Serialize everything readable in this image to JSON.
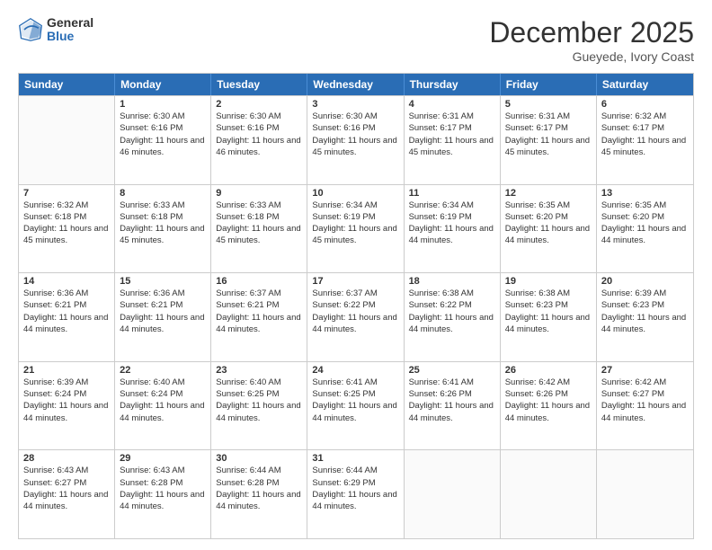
{
  "header": {
    "logo_general": "General",
    "logo_blue": "Blue",
    "month_title": "December 2025",
    "location": "Gueyede, Ivory Coast"
  },
  "days_of_week": [
    "Sunday",
    "Monday",
    "Tuesday",
    "Wednesday",
    "Thursday",
    "Friday",
    "Saturday"
  ],
  "weeks": [
    [
      {
        "day": "",
        "empty": true
      },
      {
        "day": "1",
        "sunrise": "Sunrise: 6:30 AM",
        "sunset": "Sunset: 6:16 PM",
        "daylight": "Daylight: 11 hours and 46 minutes."
      },
      {
        "day": "2",
        "sunrise": "Sunrise: 6:30 AM",
        "sunset": "Sunset: 6:16 PM",
        "daylight": "Daylight: 11 hours and 46 minutes."
      },
      {
        "day": "3",
        "sunrise": "Sunrise: 6:30 AM",
        "sunset": "Sunset: 6:16 PM",
        "daylight": "Daylight: 11 hours and 45 minutes."
      },
      {
        "day": "4",
        "sunrise": "Sunrise: 6:31 AM",
        "sunset": "Sunset: 6:17 PM",
        "daylight": "Daylight: 11 hours and 45 minutes."
      },
      {
        "day": "5",
        "sunrise": "Sunrise: 6:31 AM",
        "sunset": "Sunset: 6:17 PM",
        "daylight": "Daylight: 11 hours and 45 minutes."
      },
      {
        "day": "6",
        "sunrise": "Sunrise: 6:32 AM",
        "sunset": "Sunset: 6:17 PM",
        "daylight": "Daylight: 11 hours and 45 minutes."
      }
    ],
    [
      {
        "day": "7",
        "sunrise": "Sunrise: 6:32 AM",
        "sunset": "Sunset: 6:18 PM",
        "daylight": "Daylight: 11 hours and 45 minutes."
      },
      {
        "day": "8",
        "sunrise": "Sunrise: 6:33 AM",
        "sunset": "Sunset: 6:18 PM",
        "daylight": "Daylight: 11 hours and 45 minutes."
      },
      {
        "day": "9",
        "sunrise": "Sunrise: 6:33 AM",
        "sunset": "Sunset: 6:18 PM",
        "daylight": "Daylight: 11 hours and 45 minutes."
      },
      {
        "day": "10",
        "sunrise": "Sunrise: 6:34 AM",
        "sunset": "Sunset: 6:19 PM",
        "daylight": "Daylight: 11 hours and 45 minutes."
      },
      {
        "day": "11",
        "sunrise": "Sunrise: 6:34 AM",
        "sunset": "Sunset: 6:19 PM",
        "daylight": "Daylight: 11 hours and 44 minutes."
      },
      {
        "day": "12",
        "sunrise": "Sunrise: 6:35 AM",
        "sunset": "Sunset: 6:20 PM",
        "daylight": "Daylight: 11 hours and 44 minutes."
      },
      {
        "day": "13",
        "sunrise": "Sunrise: 6:35 AM",
        "sunset": "Sunset: 6:20 PM",
        "daylight": "Daylight: 11 hours and 44 minutes."
      }
    ],
    [
      {
        "day": "14",
        "sunrise": "Sunrise: 6:36 AM",
        "sunset": "Sunset: 6:21 PM",
        "daylight": "Daylight: 11 hours and 44 minutes."
      },
      {
        "day": "15",
        "sunrise": "Sunrise: 6:36 AM",
        "sunset": "Sunset: 6:21 PM",
        "daylight": "Daylight: 11 hours and 44 minutes."
      },
      {
        "day": "16",
        "sunrise": "Sunrise: 6:37 AM",
        "sunset": "Sunset: 6:21 PM",
        "daylight": "Daylight: 11 hours and 44 minutes."
      },
      {
        "day": "17",
        "sunrise": "Sunrise: 6:37 AM",
        "sunset": "Sunset: 6:22 PM",
        "daylight": "Daylight: 11 hours and 44 minutes."
      },
      {
        "day": "18",
        "sunrise": "Sunrise: 6:38 AM",
        "sunset": "Sunset: 6:22 PM",
        "daylight": "Daylight: 11 hours and 44 minutes."
      },
      {
        "day": "19",
        "sunrise": "Sunrise: 6:38 AM",
        "sunset": "Sunset: 6:23 PM",
        "daylight": "Daylight: 11 hours and 44 minutes."
      },
      {
        "day": "20",
        "sunrise": "Sunrise: 6:39 AM",
        "sunset": "Sunset: 6:23 PM",
        "daylight": "Daylight: 11 hours and 44 minutes."
      }
    ],
    [
      {
        "day": "21",
        "sunrise": "Sunrise: 6:39 AM",
        "sunset": "Sunset: 6:24 PM",
        "daylight": "Daylight: 11 hours and 44 minutes."
      },
      {
        "day": "22",
        "sunrise": "Sunrise: 6:40 AM",
        "sunset": "Sunset: 6:24 PM",
        "daylight": "Daylight: 11 hours and 44 minutes."
      },
      {
        "day": "23",
        "sunrise": "Sunrise: 6:40 AM",
        "sunset": "Sunset: 6:25 PM",
        "daylight": "Daylight: 11 hours and 44 minutes."
      },
      {
        "day": "24",
        "sunrise": "Sunrise: 6:41 AM",
        "sunset": "Sunset: 6:25 PM",
        "daylight": "Daylight: 11 hours and 44 minutes."
      },
      {
        "day": "25",
        "sunrise": "Sunrise: 6:41 AM",
        "sunset": "Sunset: 6:26 PM",
        "daylight": "Daylight: 11 hours and 44 minutes."
      },
      {
        "day": "26",
        "sunrise": "Sunrise: 6:42 AM",
        "sunset": "Sunset: 6:26 PM",
        "daylight": "Daylight: 11 hours and 44 minutes."
      },
      {
        "day": "27",
        "sunrise": "Sunrise: 6:42 AM",
        "sunset": "Sunset: 6:27 PM",
        "daylight": "Daylight: 11 hours and 44 minutes."
      }
    ],
    [
      {
        "day": "28",
        "sunrise": "Sunrise: 6:43 AM",
        "sunset": "Sunset: 6:27 PM",
        "daylight": "Daylight: 11 hours and 44 minutes."
      },
      {
        "day": "29",
        "sunrise": "Sunrise: 6:43 AM",
        "sunset": "Sunset: 6:28 PM",
        "daylight": "Daylight: 11 hours and 44 minutes."
      },
      {
        "day": "30",
        "sunrise": "Sunrise: 6:44 AM",
        "sunset": "Sunset: 6:28 PM",
        "daylight": "Daylight: 11 hours and 44 minutes."
      },
      {
        "day": "31",
        "sunrise": "Sunrise: 6:44 AM",
        "sunset": "Sunset: 6:29 PM",
        "daylight": "Daylight: 11 hours and 44 minutes."
      },
      {
        "day": "",
        "empty": true
      },
      {
        "day": "",
        "empty": true
      },
      {
        "day": "",
        "empty": true
      }
    ]
  ]
}
